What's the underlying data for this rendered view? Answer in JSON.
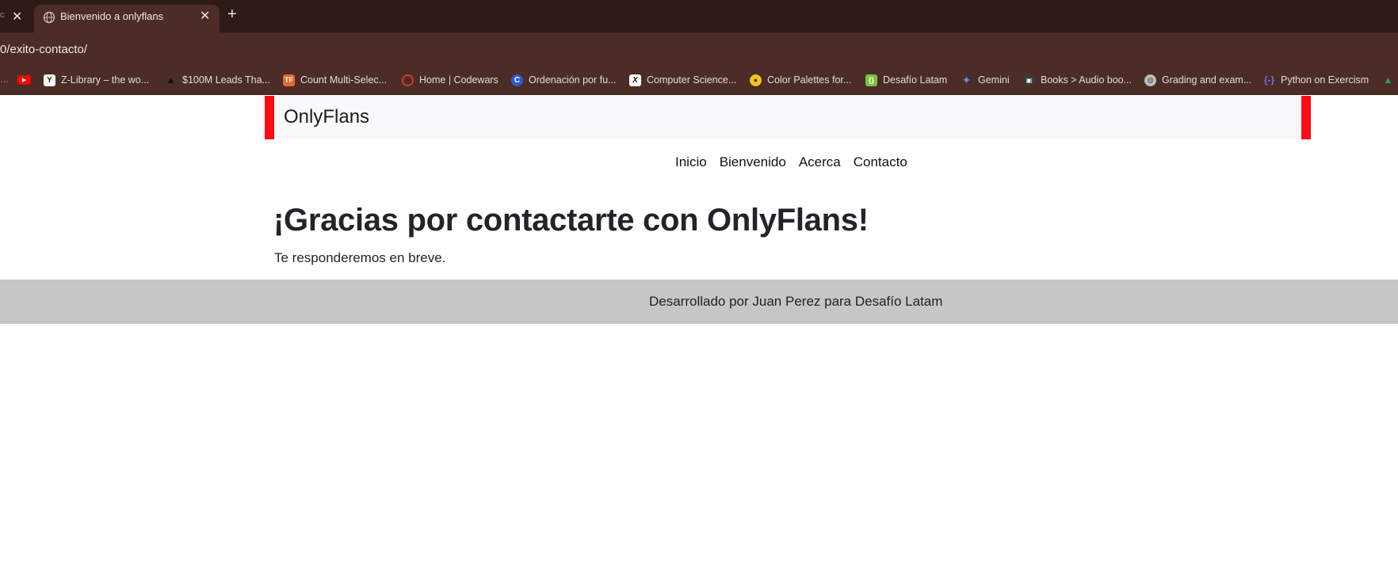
{
  "browser": {
    "partial_tab": {
      "fragment": "c",
      "close": "✕"
    },
    "active_tab": {
      "title": "Bienvenido a onlyflans",
      "close": "✕",
      "icon": "globe-icon"
    },
    "new_tab": "+",
    "address": "0/exito-contacto/",
    "bookmarks": [
      {
        "label": "",
        "icon": "youtube-icon",
        "color": "#ff0000"
      },
      {
        "label": "Z-Library – the wo...",
        "icon": "zlibrary-icon",
        "color": "#ffffff"
      },
      {
        "label": "$100M Leads Tha...",
        "icon": "triangle-icon",
        "color": "#2a1a18"
      },
      {
        "label": "Count Multi-Selec...",
        "icon": "tf-icon",
        "color": "#e8662f"
      },
      {
        "label": "Home | Codewars",
        "icon": "codewars-icon",
        "color": "#b1361e"
      },
      {
        "label": "Ordenación por fu...",
        "icon": "c-icon",
        "color": "#2a5bd7"
      },
      {
        "label": "Computer Science...",
        "icon": "x-icon",
        "color": "#111111"
      },
      {
        "label": "Color Palettes for...",
        "icon": "palette-icon",
        "color": "#f0c419"
      },
      {
        "label": "Desafío Latam",
        "icon": "desafio-icon",
        "color": "#7cc242"
      },
      {
        "label": "Gemini",
        "icon": "gemini-icon",
        "color": "#4f8cf7"
      },
      {
        "label": "Books > Audio boo...",
        "icon": "books-icon",
        "color": "#333333"
      },
      {
        "label": "Grading and exam...",
        "icon": "globe-icon",
        "color": "#bbbbbb"
      },
      {
        "label": "Python on Exercism",
        "icon": "exercism-icon",
        "color": "#604fcd"
      },
      {
        "label": "",
        "icon": "drive-icon",
        "color": "#1fa463"
      }
    ]
  },
  "site": {
    "brand": "OnlyFlans",
    "nav": {
      "inicio": "Inicio",
      "bienvenido": "Bienvenido",
      "acerca": "Acerca",
      "contacto": "Contacto"
    },
    "heading": "¡Gracias por contactarte con OnlyFlans!",
    "subtext": "Te responderemos en breve.",
    "footer": "Desarrollado por Juan Perez para Desafío Latam",
    "accent": "#ff0a14"
  }
}
